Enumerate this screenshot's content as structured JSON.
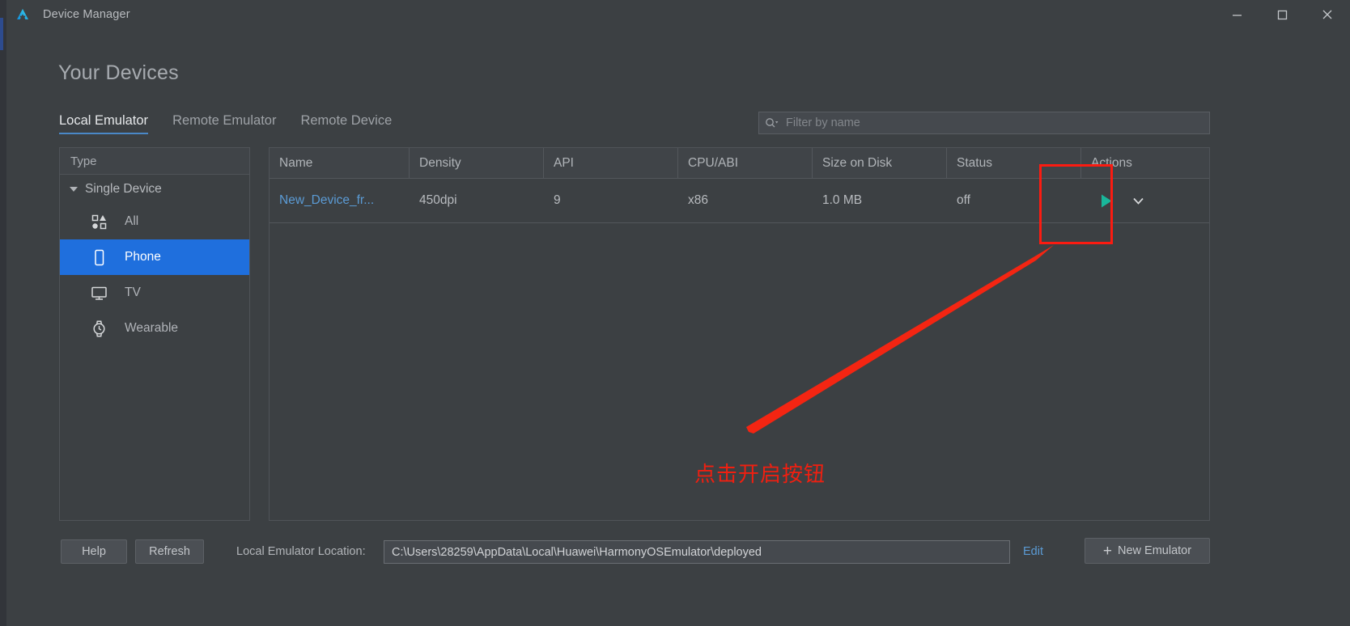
{
  "window": {
    "title": "Device Manager",
    "logo_icon": "harmony-logo-icon",
    "minimize_icon": "minimize-icon",
    "maximize_icon": "maximize-icon",
    "close_icon": "close-icon"
  },
  "page": {
    "heading": "Your Devices"
  },
  "tabs": [
    {
      "label": "Local Emulator",
      "active": true
    },
    {
      "label": "Remote Emulator",
      "active": false
    },
    {
      "label": "Remote Device",
      "active": false
    }
  ],
  "search": {
    "icon": "search-icon",
    "placeholder": "Filter by name",
    "value": ""
  },
  "sidebar": {
    "header": "Type",
    "group_label": "Single Device",
    "caret_icon": "chevron-down-icon",
    "items": [
      {
        "label": "All",
        "icon": "shapes-icon",
        "selected": false
      },
      {
        "label": "Phone",
        "icon": "phone-icon",
        "selected": true
      },
      {
        "label": "TV",
        "icon": "tv-icon",
        "selected": false
      },
      {
        "label": "Wearable",
        "icon": "watch-icon",
        "selected": false
      }
    ]
  },
  "table": {
    "columns": [
      "Name",
      "Density",
      "API",
      "CPU/ABI",
      "Size on Disk",
      "Status",
      "Actions"
    ],
    "rows": [
      {
        "name": "New_Device_fr...",
        "density": "450dpi",
        "api": "9",
        "cpu_abi": "x86",
        "size_on_disk": "1.0 MB",
        "status": "off",
        "actions": {
          "play_icon": "play-icon",
          "more_icon": "chevron-down-icon"
        }
      }
    ]
  },
  "footer": {
    "help_label": "Help",
    "refresh_label": "Refresh",
    "location_label": "Local Emulator Location:",
    "location_value": "C:\\Users\\28259\\AppData\\Local\\Huawei\\HarmonyOSEmulator\\deployed",
    "edit_label": "Edit",
    "new_emulator_label": "New Emulator",
    "new_emulator_icon": "plus-icon"
  },
  "annotation": {
    "text": "点击开启按钮",
    "color": "#f01f10",
    "highlight_box": "actions-play-button-highlight",
    "arrow": "callout-arrow"
  },
  "colors": {
    "accent_blue": "#1f6fdd",
    "link_blue": "#5b9bd5",
    "play_teal": "#19b79b",
    "background": "#3c4043",
    "annotation_red": "#f01f10"
  }
}
